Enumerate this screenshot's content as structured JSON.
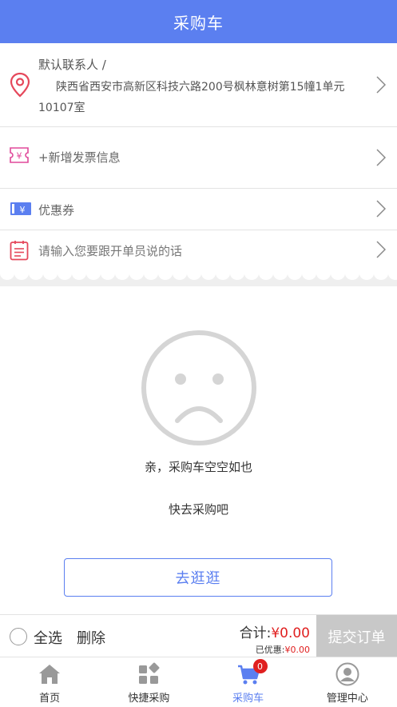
{
  "header": {
    "title": "采购车"
  },
  "address": {
    "contact": "默认联系人 /",
    "detail": "陕西省西安市高新区科技六路200号枫林意树第15幢1单元10107室"
  },
  "invoice": {
    "label": "+新增发票信息",
    "icon": "invoice-icon"
  },
  "coupon": {
    "label": "优惠券",
    "icon": "coupon-icon"
  },
  "note": {
    "placeholder": "请输入您要跟开单员说的话",
    "icon": "note-icon"
  },
  "empty": {
    "line1": "亲，采购车空空如也",
    "line2": "快去采购吧",
    "button": "去逛逛"
  },
  "footer": {
    "select_all": "全选",
    "delete": "删除",
    "total_label": "合计:",
    "total_value": "¥0.00",
    "discount_label": "已优惠:",
    "discount_value": "¥0.00",
    "submit": "提交订单"
  },
  "tabs": [
    {
      "label": "首页",
      "icon": "home-icon"
    },
    {
      "label": "快捷采购",
      "icon": "grid-icon"
    },
    {
      "label": "采购车",
      "icon": "cart-icon",
      "badge": "0"
    },
    {
      "label": "管理中心",
      "icon": "user-icon"
    }
  ],
  "colors": {
    "primary": "#5b7ff0",
    "accent_red": "#e02020",
    "disabled": "#c8c8c8"
  }
}
